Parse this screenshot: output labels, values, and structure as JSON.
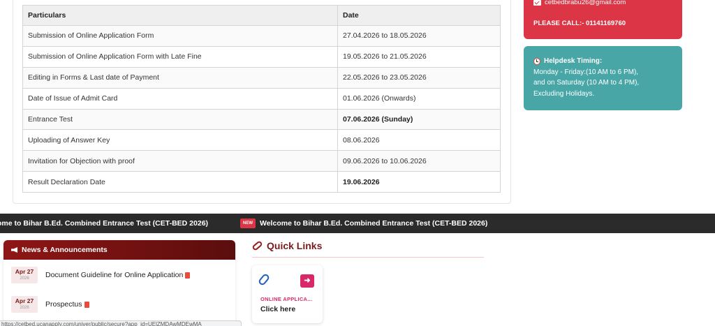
{
  "schedule": {
    "headers": [
      "Particulars",
      "Date"
    ],
    "rows": [
      {
        "particular": "Submission of Online Application Form",
        "date": "27.04.2026 to 18.05.2026"
      },
      {
        "particular": "Submission of Online Application Form with Late Fine",
        "date": "19.05.2026 to 21.05.2026"
      },
      {
        "particular": "Editing in Forms & Last date of Payment",
        "date": "22.05.2026 to 23.05.2026"
      },
      {
        "particular": "Date of Issue of Admit Card",
        "date": "01.06.2026 (Onwards)"
      },
      {
        "particular": "Entrance Test",
        "date": "07.06.2026 (Sunday)"
      },
      {
        "particular": "Uploading of Answer Key",
        "date": "08.06.2026"
      },
      {
        "particular": "Invitation for Objection with proof",
        "date": "09.06.2026 to 10.06.2026"
      },
      {
        "particular": "Result Declaration Date",
        "date": "19.06.2026"
      }
    ]
  },
  "contact": {
    "email": "cetbedbrabu26@gmail.com",
    "call": "PLEASE CALL:- 01141169760",
    "color": "#dc3545"
  },
  "helpdesk": {
    "title": "Helpdesk Timing:",
    "line1": "Monday - Friday:(10 AM to 6 PM),",
    "line2": "and on Saturday (10 AM to 4 PM),",
    "line3": "Excluding Holidays.",
    "color": "#48a6a6"
  },
  "ticker": {
    "text_partial": "ome to Bihar B.Ed. Combined Entrance Test (CET-BED 2026)",
    "badge": "NEW",
    "text": "Welcome to Bihar B.Ed. Combined Entrance Test (CET-BED 2026)"
  },
  "news": {
    "title": "News & Announcements",
    "items": [
      {
        "month_day": "Apr 27",
        "year": "2026",
        "title": "Document Guideline for Online Application"
      },
      {
        "month_day": "Apr 27",
        "year": "2026",
        "title": "Prospectus"
      }
    ]
  },
  "quick_links": {
    "title": "Quick Links",
    "card": {
      "label": "ONLINE APPLICA...",
      "cta": "Click here",
      "icon": "paperclip-icon",
      "arrow": "➜"
    }
  },
  "status_bar": {
    "url": "https://cetbed.ucanapply.com/univer/public/secure?app_id=UElZMDAwMDEwMA"
  }
}
